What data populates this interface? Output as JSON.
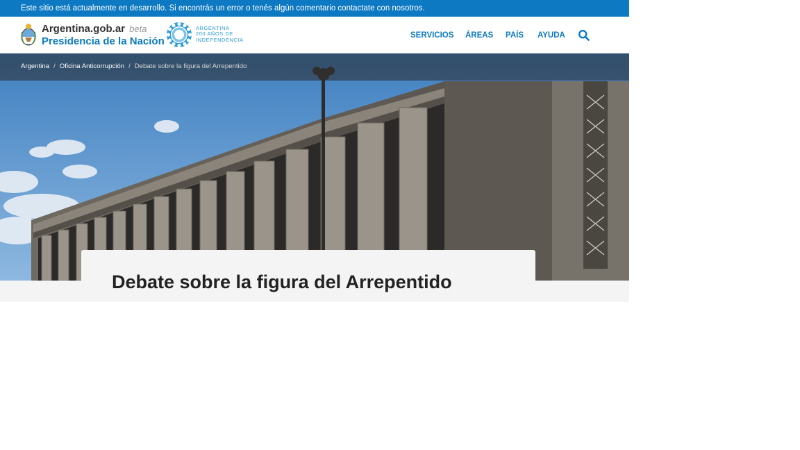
{
  "notice": {
    "text": "Este sitio está actualmente en desarrollo. Si encontrás un error o tenés algún comentario contactate con nosotros."
  },
  "header": {
    "brand_site": "Argentina.gob.ar",
    "brand_beta": "beta",
    "brand_org": "Presidencia de la Nación",
    "bicentenary": {
      "line1": "ARGENTINA",
      "line2": "200 AÑOS DE",
      "line3": "INDEPENDENCIA"
    },
    "nav": [
      {
        "label": "SERVICIOS"
      },
      {
        "label": "ÁREAS"
      },
      {
        "label": "PAÍS"
      },
      {
        "label": "AYUDA"
      }
    ],
    "search_icon": "search-icon"
  },
  "breadcrumb": {
    "items": [
      {
        "label": "Argentina"
      },
      {
        "label": "Oficina Anticorrupción"
      }
    ],
    "current": "Debate sobre la figura del Arrepentido"
  },
  "page": {
    "title": "Debate sobre la figura del Arrepentido"
  },
  "colors": {
    "brand_blue": "#0c79c2",
    "title_dark": "#222222",
    "band_gray": "#f4f4f4"
  }
}
